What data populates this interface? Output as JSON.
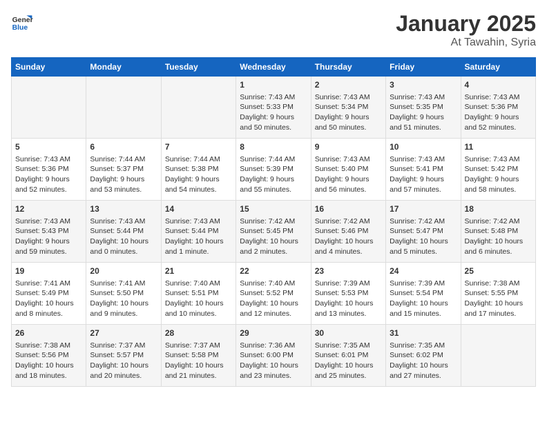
{
  "logo": {
    "line1": "General",
    "line2": "Blue"
  },
  "title": "January 2025",
  "subtitle": "At Tawahin, Syria",
  "days_header": [
    "Sunday",
    "Monday",
    "Tuesday",
    "Wednesday",
    "Thursday",
    "Friday",
    "Saturday"
  ],
  "weeks": [
    [
      {
        "day": "",
        "info": ""
      },
      {
        "day": "",
        "info": ""
      },
      {
        "day": "",
        "info": ""
      },
      {
        "day": "1",
        "info": "Sunrise: 7:43 AM\nSunset: 5:33 PM\nDaylight: 9 hours\nand 50 minutes."
      },
      {
        "day": "2",
        "info": "Sunrise: 7:43 AM\nSunset: 5:34 PM\nDaylight: 9 hours\nand 50 minutes."
      },
      {
        "day": "3",
        "info": "Sunrise: 7:43 AM\nSunset: 5:35 PM\nDaylight: 9 hours\nand 51 minutes."
      },
      {
        "day": "4",
        "info": "Sunrise: 7:43 AM\nSunset: 5:36 PM\nDaylight: 9 hours\nand 52 minutes."
      }
    ],
    [
      {
        "day": "5",
        "info": "Sunrise: 7:43 AM\nSunset: 5:36 PM\nDaylight: 9 hours\nand 52 minutes."
      },
      {
        "day": "6",
        "info": "Sunrise: 7:44 AM\nSunset: 5:37 PM\nDaylight: 9 hours\nand 53 minutes."
      },
      {
        "day": "7",
        "info": "Sunrise: 7:44 AM\nSunset: 5:38 PM\nDaylight: 9 hours\nand 54 minutes."
      },
      {
        "day": "8",
        "info": "Sunrise: 7:44 AM\nSunset: 5:39 PM\nDaylight: 9 hours\nand 55 minutes."
      },
      {
        "day": "9",
        "info": "Sunrise: 7:43 AM\nSunset: 5:40 PM\nDaylight: 9 hours\nand 56 minutes."
      },
      {
        "day": "10",
        "info": "Sunrise: 7:43 AM\nSunset: 5:41 PM\nDaylight: 9 hours\nand 57 minutes."
      },
      {
        "day": "11",
        "info": "Sunrise: 7:43 AM\nSunset: 5:42 PM\nDaylight: 9 hours\nand 58 minutes."
      }
    ],
    [
      {
        "day": "12",
        "info": "Sunrise: 7:43 AM\nSunset: 5:43 PM\nDaylight: 9 hours\nand 59 minutes."
      },
      {
        "day": "13",
        "info": "Sunrise: 7:43 AM\nSunset: 5:44 PM\nDaylight: 10 hours\nand 0 minutes."
      },
      {
        "day": "14",
        "info": "Sunrise: 7:43 AM\nSunset: 5:44 PM\nDaylight: 10 hours\nand 1 minute."
      },
      {
        "day": "15",
        "info": "Sunrise: 7:42 AM\nSunset: 5:45 PM\nDaylight: 10 hours\nand 2 minutes."
      },
      {
        "day": "16",
        "info": "Sunrise: 7:42 AM\nSunset: 5:46 PM\nDaylight: 10 hours\nand 4 minutes."
      },
      {
        "day": "17",
        "info": "Sunrise: 7:42 AM\nSunset: 5:47 PM\nDaylight: 10 hours\nand 5 minutes."
      },
      {
        "day": "18",
        "info": "Sunrise: 7:42 AM\nSunset: 5:48 PM\nDaylight: 10 hours\nand 6 minutes."
      }
    ],
    [
      {
        "day": "19",
        "info": "Sunrise: 7:41 AM\nSunset: 5:49 PM\nDaylight: 10 hours\nand 8 minutes."
      },
      {
        "day": "20",
        "info": "Sunrise: 7:41 AM\nSunset: 5:50 PM\nDaylight: 10 hours\nand 9 minutes."
      },
      {
        "day": "21",
        "info": "Sunrise: 7:40 AM\nSunset: 5:51 PM\nDaylight: 10 hours\nand 10 minutes."
      },
      {
        "day": "22",
        "info": "Sunrise: 7:40 AM\nSunset: 5:52 PM\nDaylight: 10 hours\nand 12 minutes."
      },
      {
        "day": "23",
        "info": "Sunrise: 7:39 AM\nSunset: 5:53 PM\nDaylight: 10 hours\nand 13 minutes."
      },
      {
        "day": "24",
        "info": "Sunrise: 7:39 AM\nSunset: 5:54 PM\nDaylight: 10 hours\nand 15 minutes."
      },
      {
        "day": "25",
        "info": "Sunrise: 7:38 AM\nSunset: 5:55 PM\nDaylight: 10 hours\nand 17 minutes."
      }
    ],
    [
      {
        "day": "26",
        "info": "Sunrise: 7:38 AM\nSunset: 5:56 PM\nDaylight: 10 hours\nand 18 minutes."
      },
      {
        "day": "27",
        "info": "Sunrise: 7:37 AM\nSunset: 5:57 PM\nDaylight: 10 hours\nand 20 minutes."
      },
      {
        "day": "28",
        "info": "Sunrise: 7:37 AM\nSunset: 5:58 PM\nDaylight: 10 hours\nand 21 minutes."
      },
      {
        "day": "29",
        "info": "Sunrise: 7:36 AM\nSunset: 6:00 PM\nDaylight: 10 hours\nand 23 minutes."
      },
      {
        "day": "30",
        "info": "Sunrise: 7:35 AM\nSunset: 6:01 PM\nDaylight: 10 hours\nand 25 minutes."
      },
      {
        "day": "31",
        "info": "Sunrise: 7:35 AM\nSunset: 6:02 PM\nDaylight: 10 hours\nand 27 minutes."
      },
      {
        "day": "",
        "info": ""
      }
    ]
  ]
}
